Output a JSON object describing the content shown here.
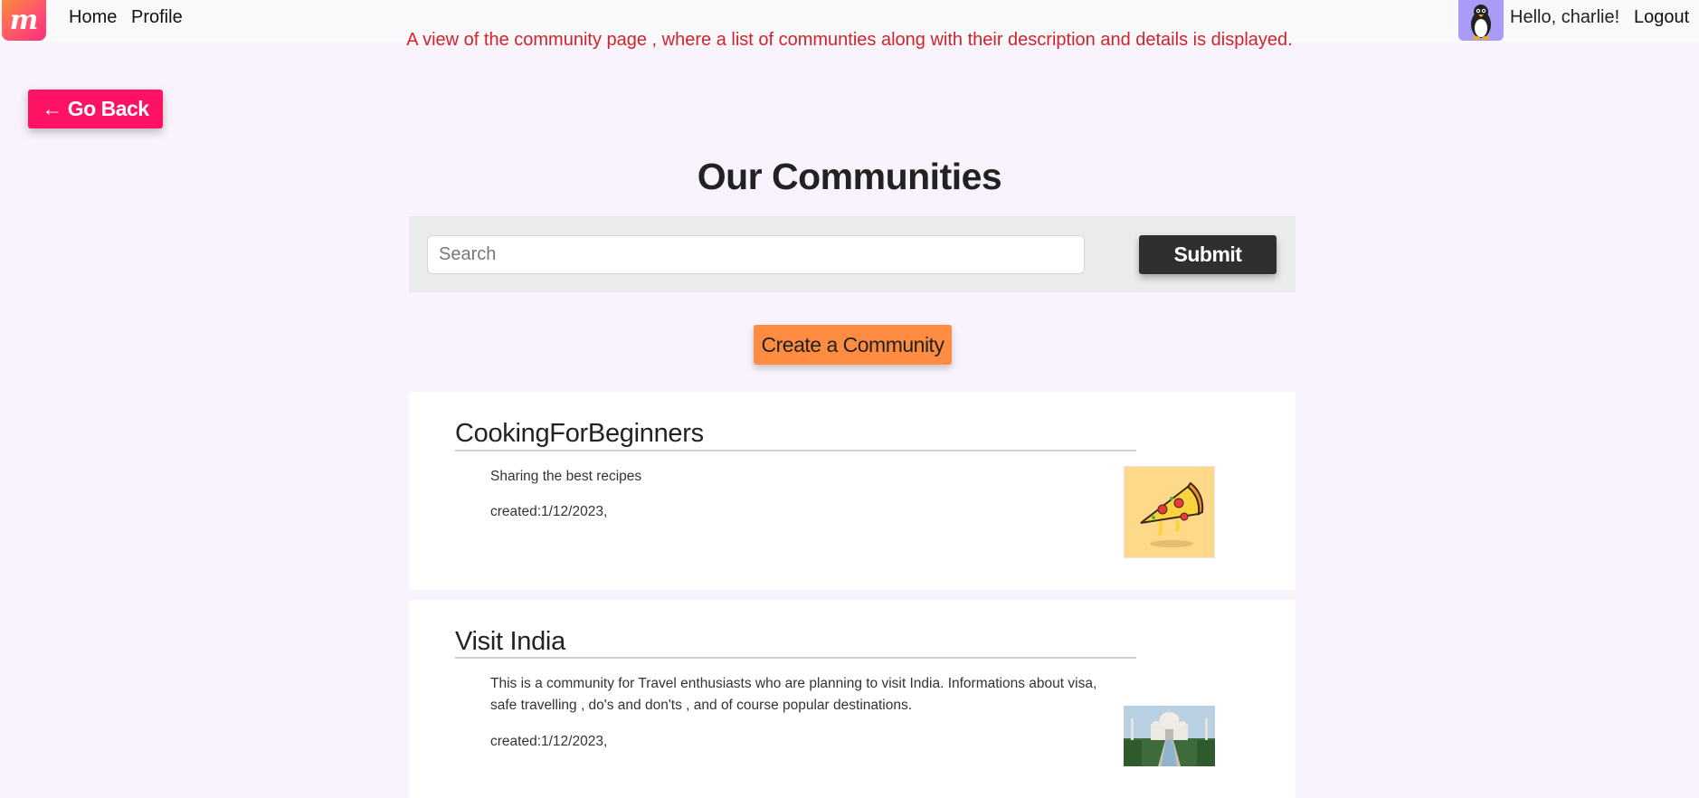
{
  "nav": {
    "logo_letter": "m",
    "home": "Home",
    "profile": "Profile",
    "greeting": "Hello, charlie!",
    "logout": "Logout"
  },
  "caption": "A view of the community page , where a list of communties along with their description and details is displayed.",
  "go_back": "← Go Back",
  "page_title": "Our Communities",
  "search": {
    "placeholder": "Search",
    "value": "",
    "submit": "Submit"
  },
  "create_button": "Create a Community",
  "communities": [
    {
      "title": "CookingForBeginners",
      "description": "Sharing the best recipes",
      "created": "created:1/12/2023,",
      "image": "pizza-image"
    },
    {
      "title": "Visit India",
      "description": "This is a community for Travel enthusiasts who are planning to visit India. Informations about visa, safe travelling , do's and don'ts , and of course popular destinations.",
      "created": "created:1/12/2023,",
      "image": "taj-mahal-image"
    }
  ],
  "colors": {
    "background": "#f9f3fd",
    "go_back": "#ff1264",
    "submit": "#2f2f2f",
    "create": "#ff8c40",
    "caption": "#d4222c",
    "avatar_bg": "#a89cf7"
  }
}
